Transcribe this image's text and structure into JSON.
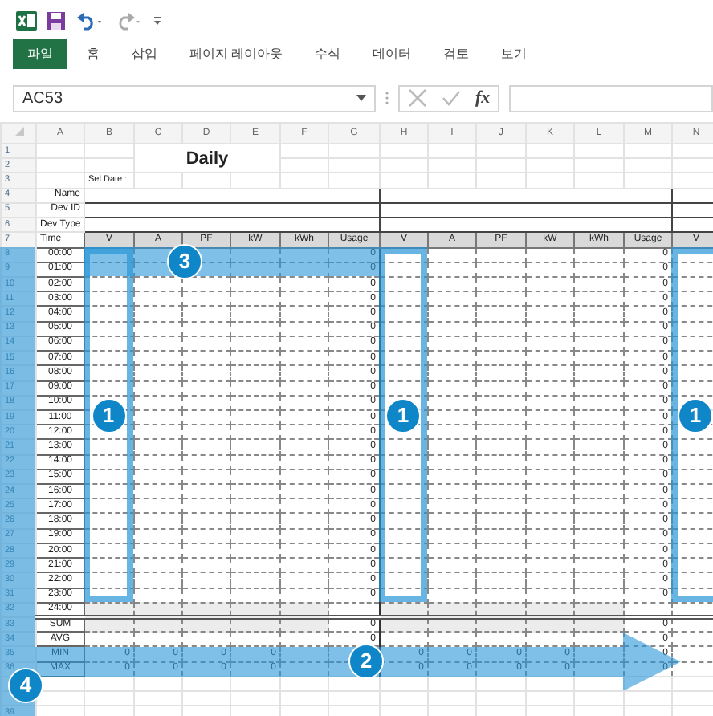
{
  "ribbon_tabs": [
    {
      "label": "파일",
      "kind": "file"
    },
    {
      "label": "홈",
      "kind": "tab"
    },
    {
      "label": "삽입",
      "kind": "tab"
    },
    {
      "label": "페이지 레이아웃",
      "kind": "tab"
    },
    {
      "label": "수식",
      "kind": "tab"
    },
    {
      "label": "데이터",
      "kind": "tab"
    },
    {
      "label": "검토",
      "kind": "tab"
    },
    {
      "label": "보기",
      "kind": "tab"
    }
  ],
  "formula_bar": {
    "name_box": "AC53",
    "function_label": "fx"
  },
  "columns": [
    "A",
    "B",
    "C",
    "D",
    "E",
    "F",
    "G",
    "H",
    "I",
    "J",
    "K",
    "L",
    "M",
    "N"
  ],
  "rows": [
    {
      "number": "1",
      "kind": "title",
      "cells": {
        "C": "Daily"
      }
    },
    {
      "number": "2",
      "kind": "title_continued"
    },
    {
      "number": "3",
      "kind": "note",
      "cells": {
        "B": "Sel Date :"
      }
    },
    {
      "number": "4",
      "kind": "info",
      "cells": {
        "A": "Name"
      }
    },
    {
      "number": "5",
      "kind": "info",
      "cells": {
        "A": "Dev ID"
      }
    },
    {
      "number": "6",
      "kind": "info",
      "cells": {
        "A": "Dev Type"
      }
    },
    {
      "number": "7",
      "kind": "header",
      "cells": {
        "A": "Time",
        "B": "V",
        "C": "A",
        "D": "PF",
        "E": "kW",
        "F": "kWh",
        "G": "Usage",
        "H": "V",
        "I": "A",
        "J": "PF",
        "K": "kW",
        "L": "kWh",
        "M": "Usage",
        "N": "V"
      }
    },
    {
      "number": "8",
      "kind": "time",
      "cells": {
        "A": "00:00",
        "G": "0",
        "M": "0"
      }
    },
    {
      "number": "9",
      "kind": "time",
      "cells": {
        "A": "01:00",
        "G": "0",
        "M": "0"
      }
    },
    {
      "number": "10",
      "kind": "time",
      "cells": {
        "A": "02:00",
        "G": "0",
        "M": "0"
      }
    },
    {
      "number": "11",
      "kind": "time",
      "cells": {
        "A": "03:00",
        "G": "0",
        "M": "0"
      }
    },
    {
      "number": "12",
      "kind": "time",
      "cells": {
        "A": "04:00",
        "G": "0",
        "M": "0"
      }
    },
    {
      "number": "13",
      "kind": "time",
      "cells": {
        "A": "05:00",
        "G": "0",
        "M": "0"
      }
    },
    {
      "number": "14",
      "kind": "time",
      "cells": {
        "A": "06:00",
        "G": "0",
        "M": "0"
      }
    },
    {
      "number": "15",
      "kind": "time",
      "cells": {
        "A": "07:00",
        "G": "0",
        "M": "0"
      }
    },
    {
      "number": "16",
      "kind": "time",
      "cells": {
        "A": "08:00",
        "G": "0",
        "M": "0"
      }
    },
    {
      "number": "17",
      "kind": "time",
      "cells": {
        "A": "09:00",
        "G": "0",
        "M": "0"
      }
    },
    {
      "number": "18",
      "kind": "time",
      "cells": {
        "A": "10:00",
        "G": "0",
        "M": "0"
      }
    },
    {
      "number": "19",
      "kind": "time",
      "cells": {
        "A": "11:00",
        "G": "0",
        "M": "0"
      }
    },
    {
      "number": "20",
      "kind": "time",
      "cells": {
        "A": "12:00",
        "G": "0",
        "M": "0"
      }
    },
    {
      "number": "21",
      "kind": "time",
      "cells": {
        "A": "13:00",
        "G": "0",
        "M": "0"
      }
    },
    {
      "number": "22",
      "kind": "time",
      "cells": {
        "A": "14:00",
        "G": "0",
        "M": "0"
      }
    },
    {
      "number": "23",
      "kind": "time",
      "cells": {
        "A": "15:00",
        "G": "0",
        "M": "0"
      }
    },
    {
      "number": "24",
      "kind": "time",
      "cells": {
        "A": "16:00",
        "G": "0",
        "M": "0"
      }
    },
    {
      "number": "25",
      "kind": "time",
      "cells": {
        "A": "17:00",
        "G": "0",
        "M": "0"
      }
    },
    {
      "number": "26",
      "kind": "time",
      "cells": {
        "A": "18:00",
        "G": "0",
        "M": "0"
      }
    },
    {
      "number": "27",
      "kind": "time",
      "cells": {
        "A": "19:00",
        "G": "0",
        "M": "0"
      }
    },
    {
      "number": "28",
      "kind": "time",
      "cells": {
        "A": "20:00",
        "G": "0",
        "M": "0"
      }
    },
    {
      "number": "29",
      "kind": "time",
      "cells": {
        "A": "21:00",
        "G": "0",
        "M": "0"
      }
    },
    {
      "number": "30",
      "kind": "time",
      "cells": {
        "A": "22:00",
        "G": "0",
        "M": "0"
      }
    },
    {
      "number": "31",
      "kind": "time",
      "cells": {
        "A": "23:00",
        "G": "0",
        "M": "0"
      }
    },
    {
      "number": "32",
      "kind": "time_end",
      "cells": {
        "A": "24:00"
      }
    },
    {
      "number": "33",
      "kind": "total",
      "cells": {
        "A": "SUM",
        "G": "0",
        "M": "0"
      }
    },
    {
      "number": "34",
      "kind": "summary",
      "cells": {
        "A": "AVG",
        "G": "0",
        "M": "0"
      }
    },
    {
      "number": "35",
      "kind": "summary",
      "cells": {
        "A": "MIN",
        "B": "0",
        "C": "0",
        "D": "0",
        "E": "0",
        "H": "0",
        "I": "0",
        "J": "0",
        "K": "0",
        "M": "0"
      }
    },
    {
      "number": "36",
      "kind": "summary",
      "cells": {
        "A": "MAX",
        "B": "0",
        "C": "0",
        "D": "0",
        "E": "0",
        "H": "0",
        "I": "0",
        "J": "0",
        "K": "0",
        "M": "0"
      }
    },
    {
      "kind": "blank"
    },
    {
      "kind": "blank"
    },
    {
      "number": "39",
      "kind": "blank"
    }
  ],
  "annotations": [
    {
      "kind": "column_frame",
      "label": "1"
    },
    {
      "kind": "column_frame",
      "label": "1"
    },
    {
      "kind": "column_frame",
      "label": "1"
    },
    {
      "kind": "row_band",
      "label": "3"
    },
    {
      "kind": "arrow",
      "label": "2"
    },
    {
      "kind": "row_header_band",
      "label": "4"
    }
  ]
}
